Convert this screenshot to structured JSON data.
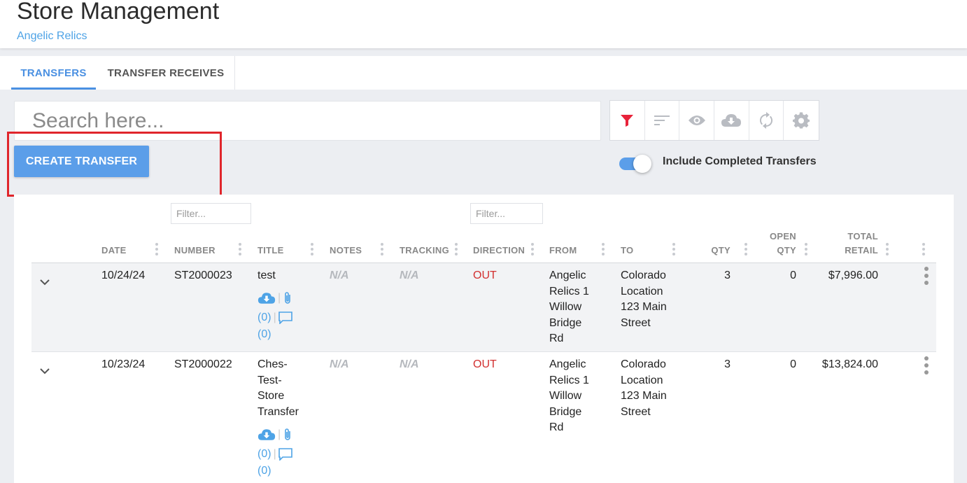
{
  "header": {
    "title": "Store Management",
    "store_name": "Angelic Relics"
  },
  "tabs": [
    {
      "label": "TRANSFERS",
      "active": true
    },
    {
      "label": "TRANSFER RECEIVES",
      "active": false
    }
  ],
  "search": {
    "placeholder": "Search here...",
    "value": ""
  },
  "toolbar": {
    "icons": [
      "filter-icon",
      "sort-icon",
      "eye-icon",
      "cloud-download-icon",
      "refresh-icon",
      "gear-icon"
    ],
    "filter_color": "#e8233a",
    "icon_color": "#b9bcc2"
  },
  "create_button": {
    "label": "CREATE TRANSFER"
  },
  "toggle": {
    "label": "Include Completed Transfers",
    "on": true
  },
  "filters": {
    "number_placeholder": "Filter...",
    "direction_placeholder": "Filter..."
  },
  "table": {
    "columns": {
      "date": "DATE",
      "number": "NUMBER",
      "title": "TITLE",
      "notes": "NOTES",
      "tracking": "TRACKING",
      "direction": "DIRECTION",
      "from": "FROM",
      "to": "TO",
      "qty": "QTY",
      "open_qty_1": "OPEN",
      "open_qty_2": "QTY",
      "total_retail_1": "TOTAL",
      "total_retail_2": "RETAIL"
    },
    "rows": [
      {
        "date": "10/24/24",
        "number": "ST2000023",
        "title": "test",
        "attachments": "(0)",
        "comments": "(0)",
        "notes": "N/A",
        "tracking": "N/A",
        "direction": "OUT",
        "from": "Angelic Relics 1 Willow Bridge Rd",
        "to": "Colorado Location 123 Main Street",
        "qty": "3",
        "open_qty": "0",
        "total_retail": "$7,996.00"
      },
      {
        "date": "10/23/24",
        "number": "ST2000022",
        "title": "Ches-Test-Store Transfer",
        "attachments": "(0)",
        "comments": "(0)",
        "notes": "N/A",
        "tracking": "N/A",
        "direction": "OUT",
        "from": "Angelic Relics 1 Willow Bridge Rd",
        "to": "Colorado Location 123 Main Street",
        "qty": "3",
        "open_qty": "0",
        "total_retail": "$13,824.00"
      }
    ]
  }
}
